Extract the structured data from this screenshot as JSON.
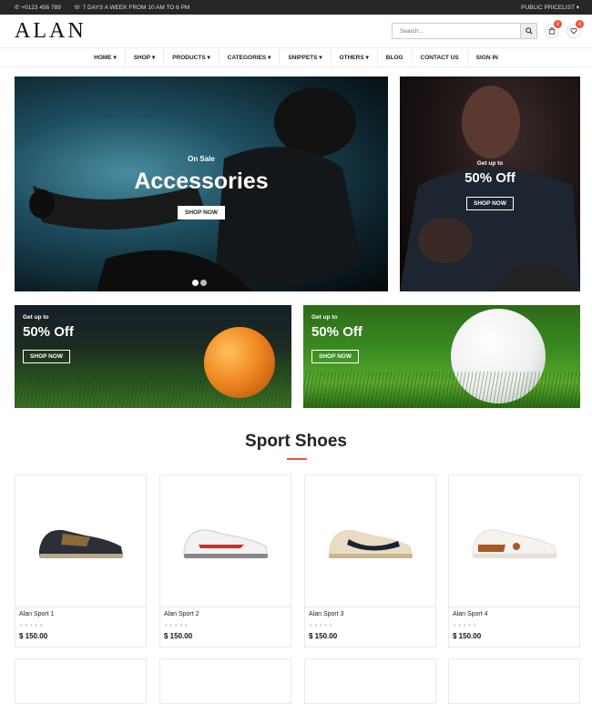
{
  "topbar": {
    "phone": "+0123 456 789",
    "hours": "7 DAYS A WEEK FROM 10 AM TO 6 PM",
    "pricelist": "PUBLIC PRICELIST"
  },
  "header": {
    "logo": "ALAN",
    "search_placeholder": "Search...",
    "cart_count": "0",
    "wishlist_count": "0"
  },
  "nav": [
    "HOME",
    "SHOP",
    "PRODUCTS",
    "CATEGORIES",
    "SNIPPETS",
    "OTHERS",
    "BLOG",
    "CONTACT US",
    "SIGN IN"
  ],
  "nav_dropdown_marker": "▾",
  "hero": {
    "kicker": "On Sale",
    "title": "Accessories",
    "button": "SHOP NOW"
  },
  "hero_side": {
    "kicker": "Get up to",
    "title": "50% Off",
    "button": "SHOP NOW"
  },
  "banners": [
    {
      "kicker": "Get up to",
      "title": "50% Off",
      "button": "SHOP NOW"
    },
    {
      "kicker": "Get up to",
      "title": "50% Off",
      "button": "SHOP NOW"
    }
  ],
  "section": {
    "title": "Sport Shoes"
  },
  "products": [
    {
      "name": "Alan Sport 1",
      "price": "$ 150.00",
      "stars": "★★★★★"
    },
    {
      "name": "Alan Sport 2",
      "price": "$ 150.00",
      "stars": "★★★★★"
    },
    {
      "name": "Alan Sport 3",
      "price": "$ 150.00",
      "stars": "★★★★★"
    },
    {
      "name": "Alan Sport 4",
      "price": "$ 150.00",
      "stars": "★★★★★"
    }
  ],
  "colors": {
    "accent": "#e6543c",
    "topbar": "#262626"
  }
}
